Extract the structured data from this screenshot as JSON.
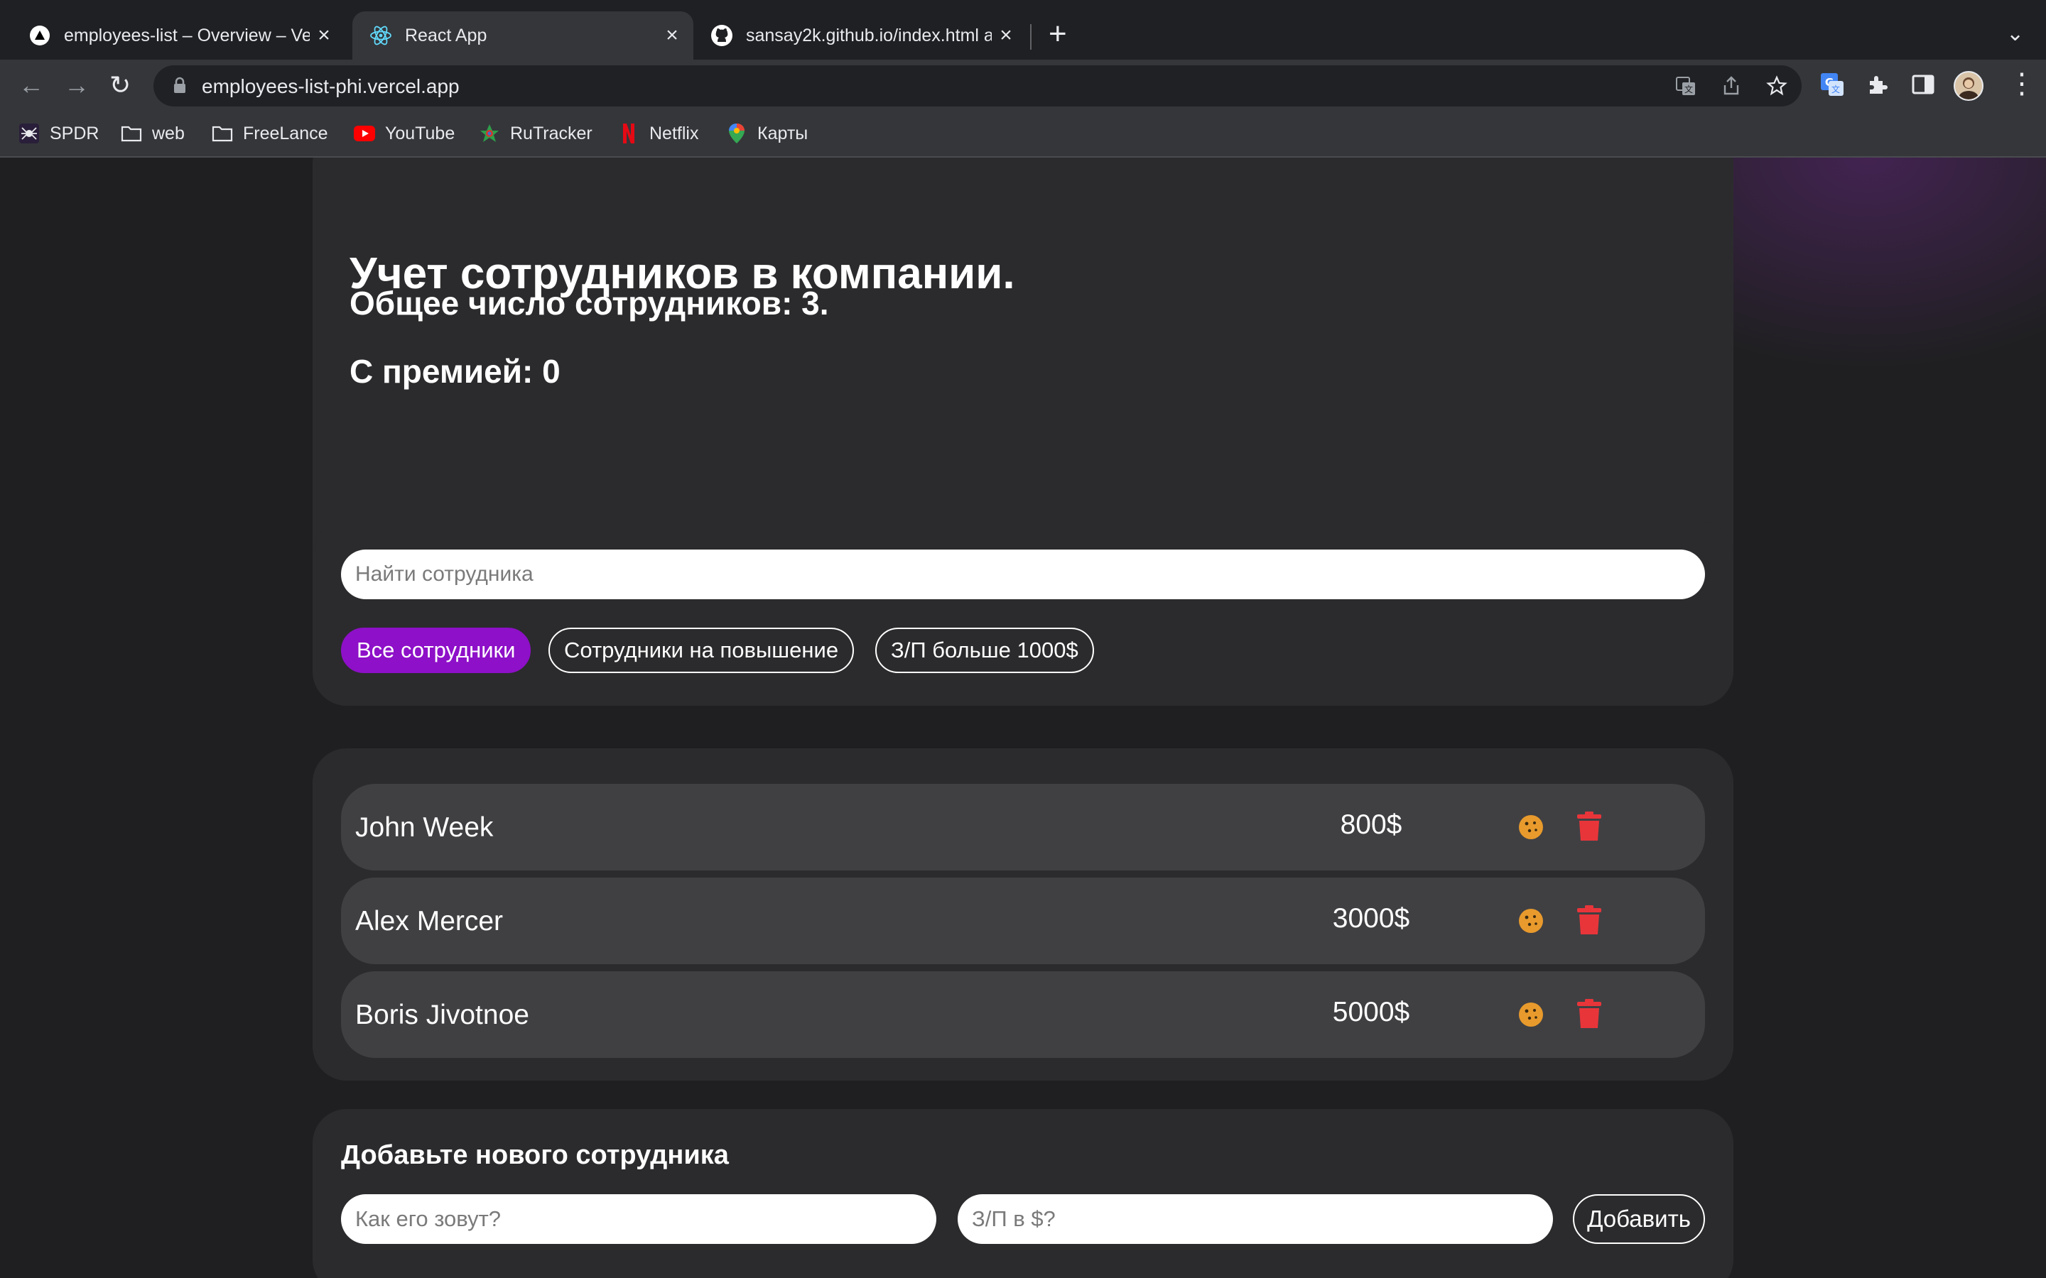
{
  "browser": {
    "tabs": [
      {
        "title": "employees-list – Overview – Vercel",
        "active": false
      },
      {
        "title": "React App",
        "active": true
      },
      {
        "title": "sansay2k.github.io/index.html at",
        "active": false
      }
    ],
    "url": "employees-list-phi.vercel.app",
    "bookmarks": [
      {
        "label": "SPDR",
        "icon": "spider-icon"
      },
      {
        "label": "web",
        "icon": "folder-icon"
      },
      {
        "label": "FreeLance",
        "icon": "folder-icon"
      },
      {
        "label": "YouTube",
        "icon": "youtube-icon"
      },
      {
        "label": "RuTracker",
        "icon": "rutracker-icon"
      },
      {
        "label": "Netflix",
        "icon": "netflix-icon"
      },
      {
        "label": "Карты",
        "icon": "maps-icon"
      }
    ]
  },
  "app_info": {
    "title": "Учет сотрудников в компании.",
    "total_line": "Общее число сотрудников: 3.",
    "bonus_line": "С премией: 0"
  },
  "search": {
    "placeholder": "Найти сотрудника",
    "filters": [
      {
        "label": "Все сотрудники",
        "active": true
      },
      {
        "label": "Сотрудники на повышение",
        "active": false
      },
      {
        "label": "З/П больше 1000$",
        "active": false
      }
    ]
  },
  "employees": [
    {
      "name": "John Week",
      "salary": "800$"
    },
    {
      "name": "Alex Mercer",
      "salary": "3000$"
    },
    {
      "name": "Boris Jivotnoe",
      "salary": "5000$"
    }
  ],
  "add_form": {
    "title": "Добавьте нового сотрудника",
    "name_placeholder": "Как его зовут?",
    "salary_placeholder": "З/П в $?",
    "submit_label": "Добавить"
  },
  "colors": {
    "accent": "#8e10c8",
    "cookie": "#e89a2c",
    "trash": "#e8353a",
    "card": "#2b2b2d",
    "row": "#404043"
  }
}
